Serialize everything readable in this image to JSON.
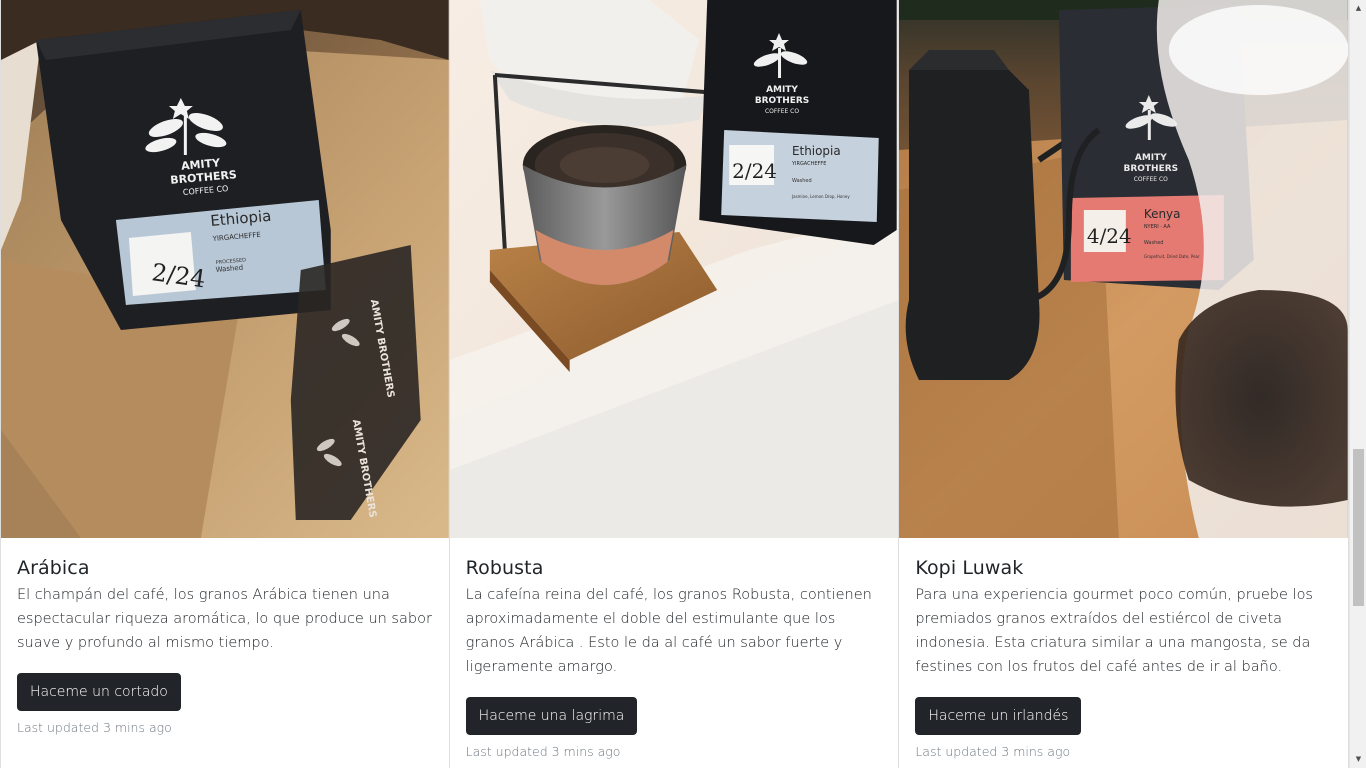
{
  "cards": [
    {
      "image_alt": "Amity Brothers coffee bag Ethiopia Yirgacheffe in cardboard box",
      "title": "Arábica",
      "text": "El champán del café, los granos Arábica tienen una espectacular riqueza aromática, lo que produce un sabor suave y profundo al mismo tiempo.",
      "button_label": "Haceme un cortado",
      "updated": "Last updated 3 mins ago",
      "bag_label": "Ethiopia",
      "bag_sub": "YIRGACHEFFE",
      "bag_date": "2/24",
      "brand": "AMITY BROTHERS COFFEE CO"
    },
    {
      "image_alt": "Pour-over coffee dripper with cup and Amity Brothers Ethiopia bag",
      "title": "Robusta",
      "text": "La cafeína reina del café, los granos Robusta, contienen aproximadamente el doble del estimulante que los granos Arábica . Esto le da al café un sabor fuerte y ligeramente amargo.",
      "button_label": "Haceme una lagrima",
      "updated": "Last updated 3 mins ago",
      "bag_label": "Ethiopia",
      "bag_sub": "YIRGACHEFFE",
      "bag_date": "2/24",
      "brand": "AMITY BROTHERS COFFEE CO"
    },
    {
      "image_alt": "Black kettle next to Amity Brothers Kenya coffee bag",
      "title": "Kopi Luwak",
      "text": "Para una experiencia gourmet poco común, pruebe los premiados granos extraídos del estiércol de civeta indonesia. Esta criatura similar a una mangosta, se da festines con los frutos del café antes de ir al baño.",
      "button_label": "Haceme un irlandés",
      "updated": "Last updated 3 mins ago",
      "bag_label": "Kenya",
      "bag_sub": "NYERI · AA",
      "bag_date": "4/24",
      "brand": "AMITY BROTHERS COFFEE CO"
    }
  ],
  "colors": {
    "button_bg": "#212529",
    "muted_text": "#6c757d",
    "border": "rgba(0,0,0,0.13)"
  },
  "scrollbar": {
    "up_icon": "scroll-up-arrow-icon",
    "down_icon": "scroll-down-arrow-icon"
  }
}
